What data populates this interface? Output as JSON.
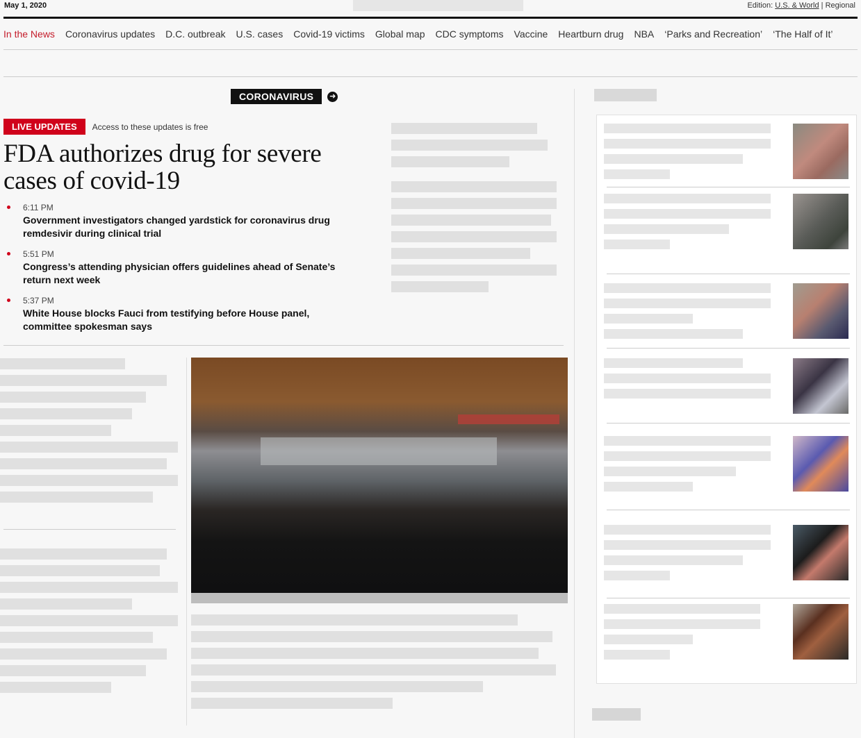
{
  "topbar": {
    "date": "May 1, 2020",
    "edition_prefix": "Edition:",
    "edition_us_world": "U.S. & World",
    "edition_sep": "|",
    "edition_regional": "Regional"
  },
  "nav": {
    "items": [
      {
        "label": "In the News",
        "active": true
      },
      {
        "label": "Coronavirus updates"
      },
      {
        "label": "D.C. outbreak"
      },
      {
        "label": "U.S. cases"
      },
      {
        "label": "Covid-19 victims"
      },
      {
        "label": "Global map"
      },
      {
        "label": "CDC symptoms"
      },
      {
        "label": "Vaccine"
      },
      {
        "label": "Heartburn drug"
      },
      {
        "label": "NBA"
      },
      {
        "label": "‘Parks and Recreation’"
      },
      {
        "label": "‘The Half of It’"
      }
    ]
  },
  "kicker": {
    "label": "CORONAVIRUS",
    "icon": "arrow-circle-right-icon"
  },
  "live": {
    "badge": "LIVE UPDATES",
    "note": "Access to these updates is free"
  },
  "headline": "FDA authorizes drug for severe cases of covid-19",
  "updates": [
    {
      "time": "6:11 PM",
      "text": "Government investigators changed yardstick for coronavirus drug remdesivir during clinical trial"
    },
    {
      "time": "5:51 PM",
      "text": "Congress’s attending physician offers guidelines ahead of Senate’s return next week"
    },
    {
      "time": "5:37 PM",
      "text": "White House blocks Fauci from testifying before House panel, committee spokesman says"
    }
  ],
  "colors": {
    "accent_red": "#c41d2b",
    "live_red": "#d0021b",
    "rule": "#111111"
  }
}
